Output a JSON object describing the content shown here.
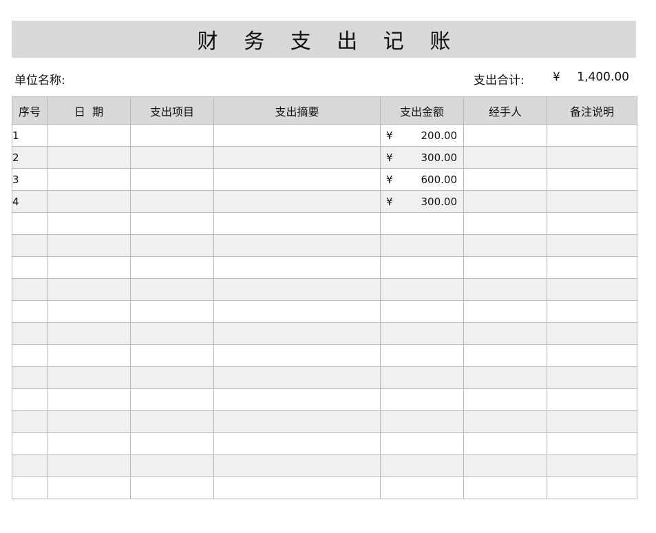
{
  "title": "财 务 支 出 记 账",
  "unit_label": "单位名称:",
  "total_label": "支出合计:",
  "total_currency": "¥",
  "total_value": "1,400.00",
  "headers": [
    "序号",
    "日  期",
    "支出项目",
    "支出摘要",
    "支出金额",
    "经手人",
    "备注说明"
  ],
  "rows": [
    {
      "seq": "1",
      "currency": "¥",
      "amount": "200.00"
    },
    {
      "seq": "2",
      "currency": "¥",
      "amount": "300.00"
    },
    {
      "seq": "3",
      "currency": "¥",
      "amount": "600.00"
    },
    {
      "seq": "4",
      "currency": "¥",
      "amount": "300.00"
    },
    {
      "seq": "",
      "currency": "",
      "amount": ""
    },
    {
      "seq": "",
      "currency": "",
      "amount": ""
    },
    {
      "seq": "",
      "currency": "",
      "amount": ""
    },
    {
      "seq": "",
      "currency": "",
      "amount": ""
    },
    {
      "seq": "",
      "currency": "",
      "amount": ""
    },
    {
      "seq": "",
      "currency": "",
      "amount": ""
    },
    {
      "seq": "",
      "currency": "",
      "amount": ""
    },
    {
      "seq": "",
      "currency": "",
      "amount": ""
    },
    {
      "seq": "",
      "currency": "",
      "amount": ""
    },
    {
      "seq": "",
      "currency": "",
      "amount": ""
    },
    {
      "seq": "",
      "currency": "",
      "amount": ""
    },
    {
      "seq": "",
      "currency": "",
      "amount": ""
    },
    {
      "seq": "",
      "currency": "",
      "amount": ""
    }
  ]
}
